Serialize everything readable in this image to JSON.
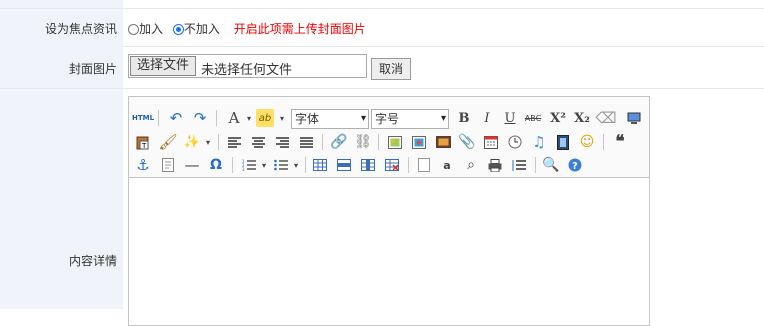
{
  "focus_row": {
    "label": "设为焦点资讯",
    "option_add": "加入",
    "option_no_add": "不加入",
    "hint": "开启此项需上传封面图片"
  },
  "cover_row": {
    "label": "封面图片",
    "choose_button": "选择文件",
    "no_file_text": "未选择任何文件",
    "cancel_button": "取消"
  },
  "content_row": {
    "label": "内容详情",
    "font_family_select": "字体",
    "font_size_select": "字号"
  }
}
